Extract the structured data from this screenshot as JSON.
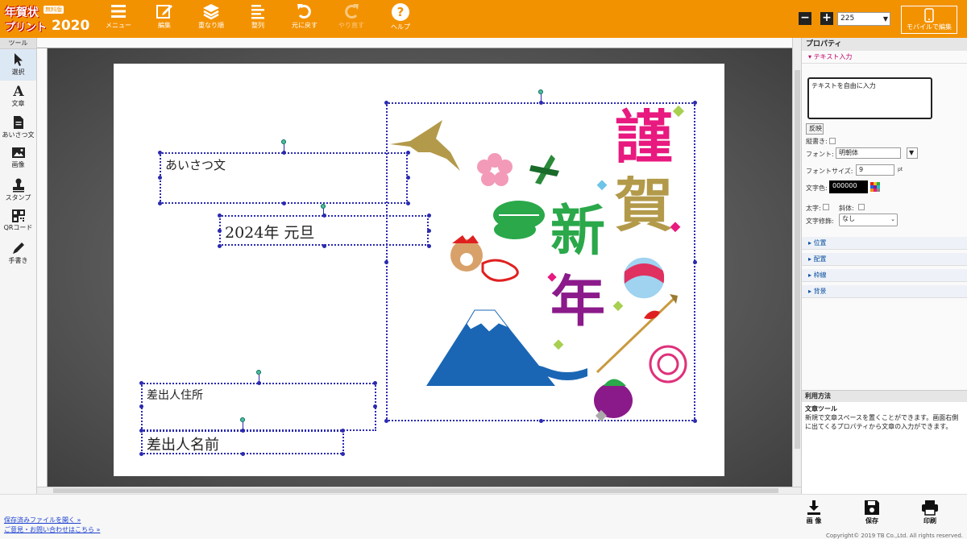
{
  "app": {
    "logo_line1": "年賀状",
    "logo_badge": "無料版",
    "logo_line2": "プリント",
    "logo_year": "2020"
  },
  "toolbar": {
    "menu": "メニュー",
    "edit": "編集",
    "layers": "重なり順",
    "align": "整列",
    "undo": "元に戻す",
    "redo": "やり直す",
    "help": "ヘルプ"
  },
  "zoom": {
    "minus": "−",
    "plus": "+",
    "value": "225"
  },
  "mobile_edit": "モバイルで編集",
  "tools": {
    "header": "ツール",
    "items": [
      {
        "label": "選択",
        "icon": "pointer-icon"
      },
      {
        "label": "文章",
        "icon": "text-icon"
      },
      {
        "label": "あいさつ文",
        "icon": "document-icon"
      },
      {
        "label": "画像",
        "icon": "image-icon"
      },
      {
        "label": "スタンプ",
        "icon": "stamp-icon"
      },
      {
        "label": "QRコード",
        "icon": "qr-icon"
      },
      {
        "label": "手書き",
        "icon": "pencil-icon"
      }
    ]
  },
  "card": {
    "greeting_placeholder": "あいさつ文",
    "date_text": "2024年 元旦",
    "sender_address": "差出人住所",
    "sender_name": "差出人名前",
    "kanji1": "謹",
    "kanji2": "賀",
    "kanji3": "新",
    "kanji4": "年"
  },
  "props": {
    "header": "プロパティ",
    "section_text": "テキスト入力",
    "textarea_placeholder": "テキストを自由に入力",
    "apply": "反映",
    "vertical": "縦書き:",
    "font_label": "フォント:",
    "font_value": "明朝体",
    "size_label": "フォントサイズ:",
    "size_value": "9",
    "size_unit": "pt",
    "color_label": "文字色:",
    "color_value": "000000",
    "bold": "太字:",
    "italic": "斜体:",
    "decoration_label": "文字修飾:",
    "decoration_value": "なし",
    "sections": [
      "位置",
      "配置",
      "枠線",
      "背景"
    ]
  },
  "usage": {
    "header": "利用方法",
    "title": "文章ツール",
    "body": "新規で文章スペースを置くことができます。画面右側に出てくるプロパティから文章の入力ができます。"
  },
  "footer": {
    "open_link": "保存済みファイルを開く »",
    "contact_link": "ご意見・お問い合わせはこちら »",
    "image": "画 像",
    "save": "保存",
    "print": "印刷",
    "copyright": "Copyright© 2019 TB Co.,Ltd. All rights reserved."
  },
  "colors": {
    "header": "#f39200",
    "selection": "#2a2ab0",
    "kanji_pink": "#e8197f",
    "kanji_gold": "#b39a4a",
    "kanji_green": "#2aa84a",
    "kanji_purple": "#8b1a8b"
  }
}
